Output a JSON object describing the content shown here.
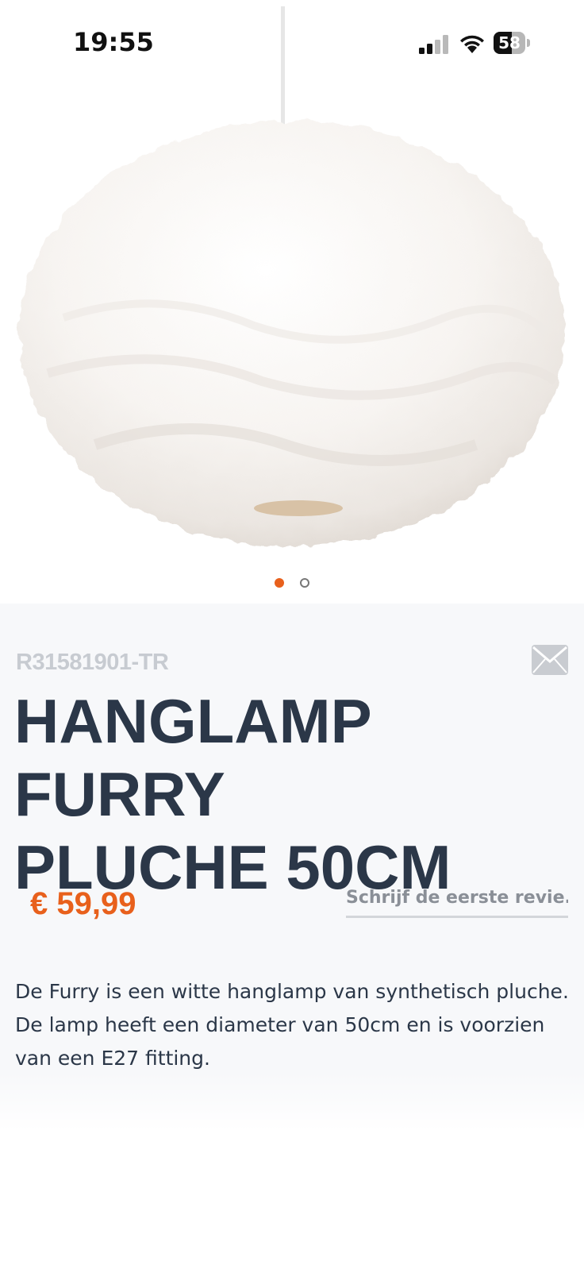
{
  "status_bar": {
    "time": "19:55",
    "battery_level": "58",
    "battery_fraction": 0.58,
    "icons": [
      "signal-icon",
      "wifi-icon",
      "battery-icon"
    ]
  },
  "gallery": {
    "image_subject": "white furry pendant lamp",
    "slide_count": 2,
    "active_slide": 1
  },
  "product": {
    "sku": "R31581901-TR",
    "title_line1": "HANGLAMP FURRY",
    "title_line2": "PLUCHE 50CM",
    "price": "€ 59,99",
    "review_link": "Schrijf de eerste revie...",
    "description": "De Furry is een witte hanglamp van synthetisch pluche. De lamp heeft een diameter van 50cm en is voorzien van een E27 fitting."
  },
  "colors": {
    "accent": "#e8601c",
    "title": "#2b3748",
    "sku": "#c7cbd1",
    "background": "#f7f8fa"
  }
}
